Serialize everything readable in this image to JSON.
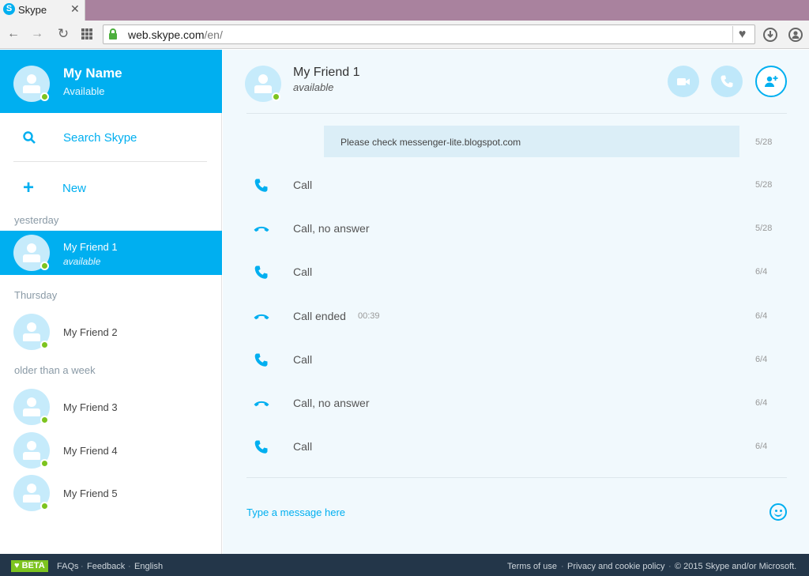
{
  "browser": {
    "tab_title": "Skype",
    "tab_logo_letter": "S",
    "url_domain": "web.skype.com",
    "url_path": "/en/"
  },
  "me": {
    "name": "My Name",
    "status": "Available"
  },
  "sidebar": {
    "search_label": "Search Skype",
    "new_label": "New",
    "groups": [
      "yesterday",
      "Thursday",
      "older than a week"
    ],
    "contacts": [
      {
        "name": "My Friend 1",
        "status": "available"
      },
      {
        "name": "My Friend 2"
      },
      {
        "name": "My Friend 3"
      },
      {
        "name": "My Friend 4"
      },
      {
        "name": "My Friend 5"
      }
    ]
  },
  "conversation": {
    "name": "My Friend 1",
    "status": "available",
    "sent_message": "Please check messenger-lite.blogspot.com",
    "sent_date": "5/28",
    "calls": [
      {
        "label": "Call",
        "date": "5/28",
        "kind": "call"
      },
      {
        "label": "Call, no answer",
        "date": "5/28",
        "kind": "hangup"
      },
      {
        "label": "Call",
        "date": "6/4",
        "kind": "call"
      },
      {
        "label": "Call ended",
        "duration": "00:39",
        "date": "6/4",
        "kind": "hangup"
      },
      {
        "label": "Call",
        "date": "6/4",
        "kind": "call"
      },
      {
        "label": "Call, no answer",
        "date": "6/4",
        "kind": "hangup"
      },
      {
        "label": "Call",
        "date": "6/4",
        "kind": "call"
      }
    ],
    "input_placeholder": "Type a message here"
  },
  "footer": {
    "beta": "♥ BETA",
    "left_links": [
      "FAQs",
      "Feedback",
      "English"
    ],
    "right_links": [
      "Terms of use",
      "Privacy and cookie policy"
    ],
    "copyright": "© 2015 Skype and/or Microsoft."
  },
  "colors": {
    "accent": "#00aff0",
    "presence": "#7dc41f",
    "footer_bg": "#233649",
    "conversation_bg": "#f1f9fd"
  }
}
